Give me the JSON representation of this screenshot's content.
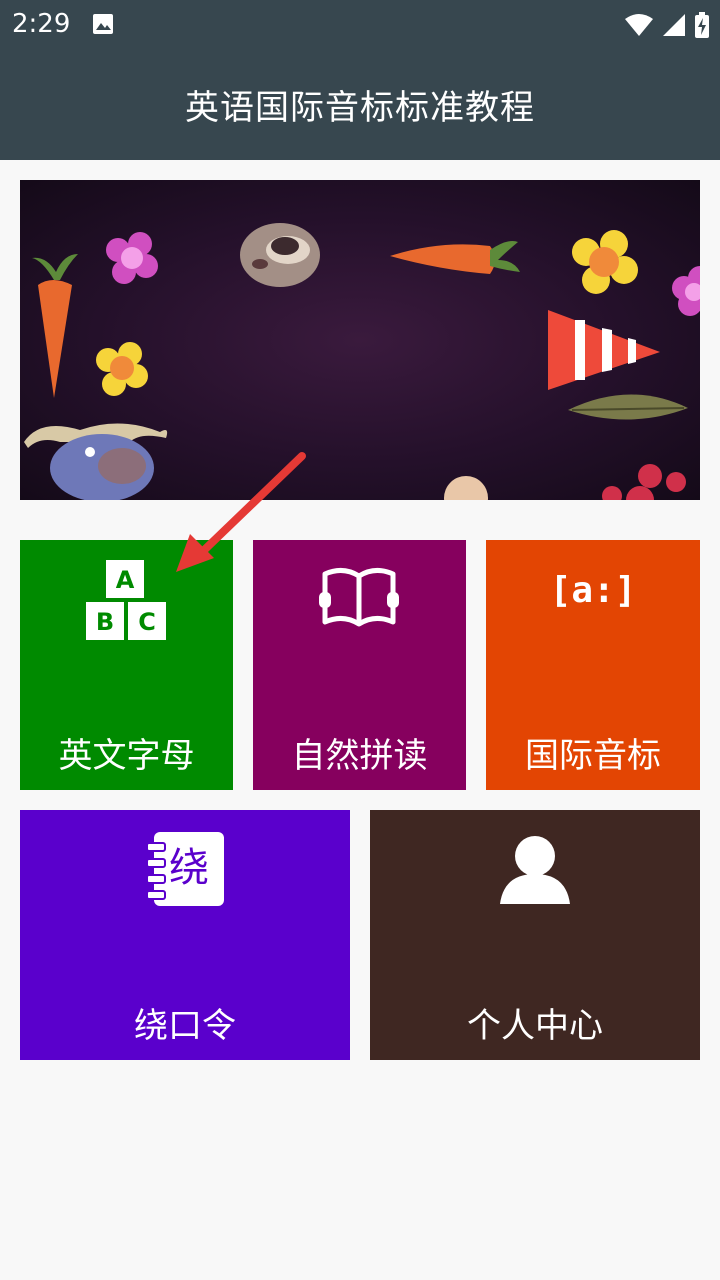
{
  "status_bar": {
    "time": "2:29",
    "icons": [
      "image-icon",
      "wifi-icon",
      "signal-icon",
      "battery-icon"
    ]
  },
  "app_bar": {
    "title": "英语国际音标标准教程"
  },
  "banner": {
    "illustration": "zoo animals and carrots cartoon banner"
  },
  "tiles": [
    {
      "label": "英文字母",
      "icon": "abc-blocks-icon",
      "color": "#008a00"
    },
    {
      "label": "自然拼读",
      "icon": "open-book-icon",
      "color": "#86005e"
    },
    {
      "label": "国际音标",
      "icon": "phonetic-bracket-icon",
      "icon_text": "[a:]",
      "color": "#e34503"
    },
    {
      "label": "绕口令",
      "icon": "notebook-icon",
      "icon_text": "绕",
      "color": "#5a00cc"
    },
    {
      "label": "个人中心",
      "icon": "person-icon",
      "color": "#3f2722"
    }
  ],
  "blocks_icon_letters": [
    "A",
    "B",
    "C"
  ],
  "annotation": {
    "color": "#e53935"
  }
}
